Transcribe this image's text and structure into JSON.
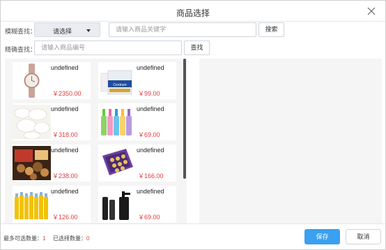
{
  "dialog": {
    "title": "商品选择",
    "close_icon": "close-icon"
  },
  "search": {
    "fuzzy_label": "模糊查找：",
    "select_label": "请选择",
    "keyword_placeholder": "请输入商品关键字",
    "search_button": "搜索",
    "exact_label": "精确查找：",
    "code_placeholder": "请输入商品编号",
    "find_button": "查找"
  },
  "products": [
    {
      "name": "undefined",
      "price": "￥2350.00",
      "image": "watch-image"
    },
    {
      "name": "undefined",
      "price": "￥99.00",
      "image": "vitamin-box-image"
    },
    {
      "name": "undefined",
      "price": "￥318.00",
      "image": "tableware-image"
    },
    {
      "name": "undefined",
      "price": "￥69.00",
      "image": "bottles-image"
    },
    {
      "name": "undefined",
      "price": "￥238.00",
      "image": "nuts-gift-box-image"
    },
    {
      "name": "undefined",
      "price": "￥166.00",
      "image": "chocolate-box-image"
    },
    {
      "name": "undefined",
      "price": "￥126.00",
      "image": "juice-bottles-image"
    },
    {
      "name": "undefined",
      "price": "￥69.00",
      "image": "cosmetics-set-image"
    }
  ],
  "footer": {
    "max_label": "最多可选数量：",
    "max_value": "1",
    "selected_label": "已选择数量：",
    "selected_value": "0",
    "save_button": "保存",
    "cancel_button": "取消"
  },
  "colors": {
    "primary": "#3aa0ef",
    "price": "#e4393c",
    "panel_bg": "#f5f5f5"
  }
}
